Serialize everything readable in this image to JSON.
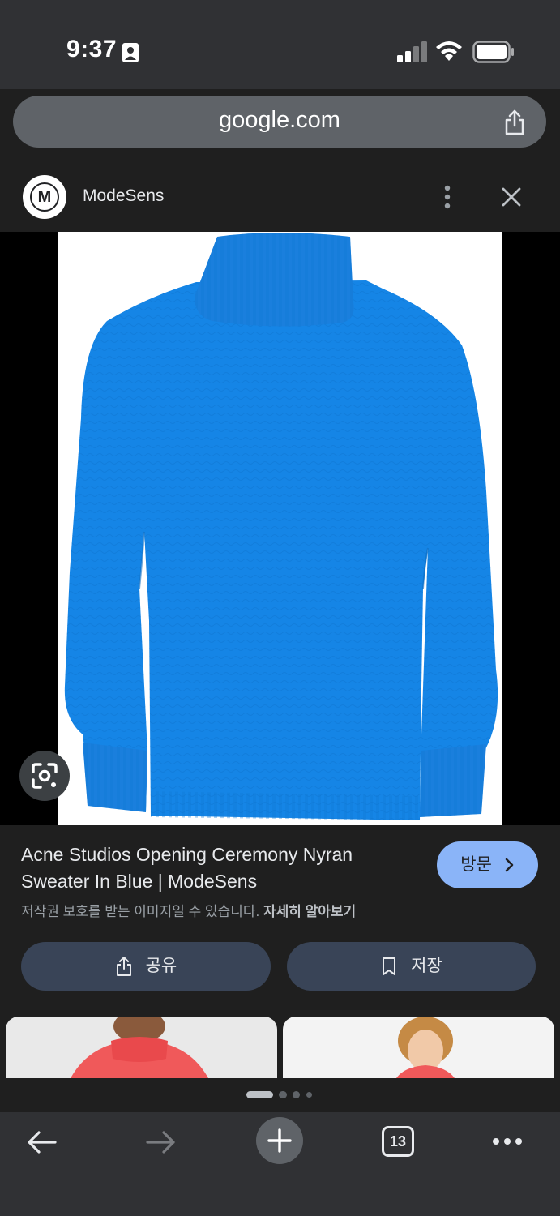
{
  "status_bar": {
    "time": "9:37"
  },
  "browser": {
    "url": "google.com",
    "tab_count": "13"
  },
  "source": {
    "logo_letter": "M",
    "name": "ModeSens"
  },
  "result": {
    "title": "Acne Studios Opening Ceremony Nyran Sweater In Blue | ModeSens",
    "copyright_notice": "저작권 보호를 받는 이미지일 수 있습니다.",
    "learn_more": "자세히 알아보기",
    "visit_label": "방문",
    "share_label": "공유",
    "save_label": "저장"
  },
  "colors": {
    "sweater": "#1585e6",
    "accent": "#8ab4f8",
    "action_button": "#394457"
  },
  "pager": {
    "page_count": 4,
    "active_index": 0
  },
  "icons": {
    "status": [
      "id-card-icon",
      "signal-icon",
      "wifi-icon",
      "battery-icon"
    ],
    "toolbar": [
      "share-icon"
    ],
    "header": [
      "more-vertical-icon",
      "close-icon"
    ],
    "image": [
      "google-lens-icon"
    ],
    "bottom": [
      "back-arrow-icon",
      "forward-arrow-icon",
      "plus-icon",
      "tabs-icon",
      "more-horizontal-icon"
    ]
  }
}
